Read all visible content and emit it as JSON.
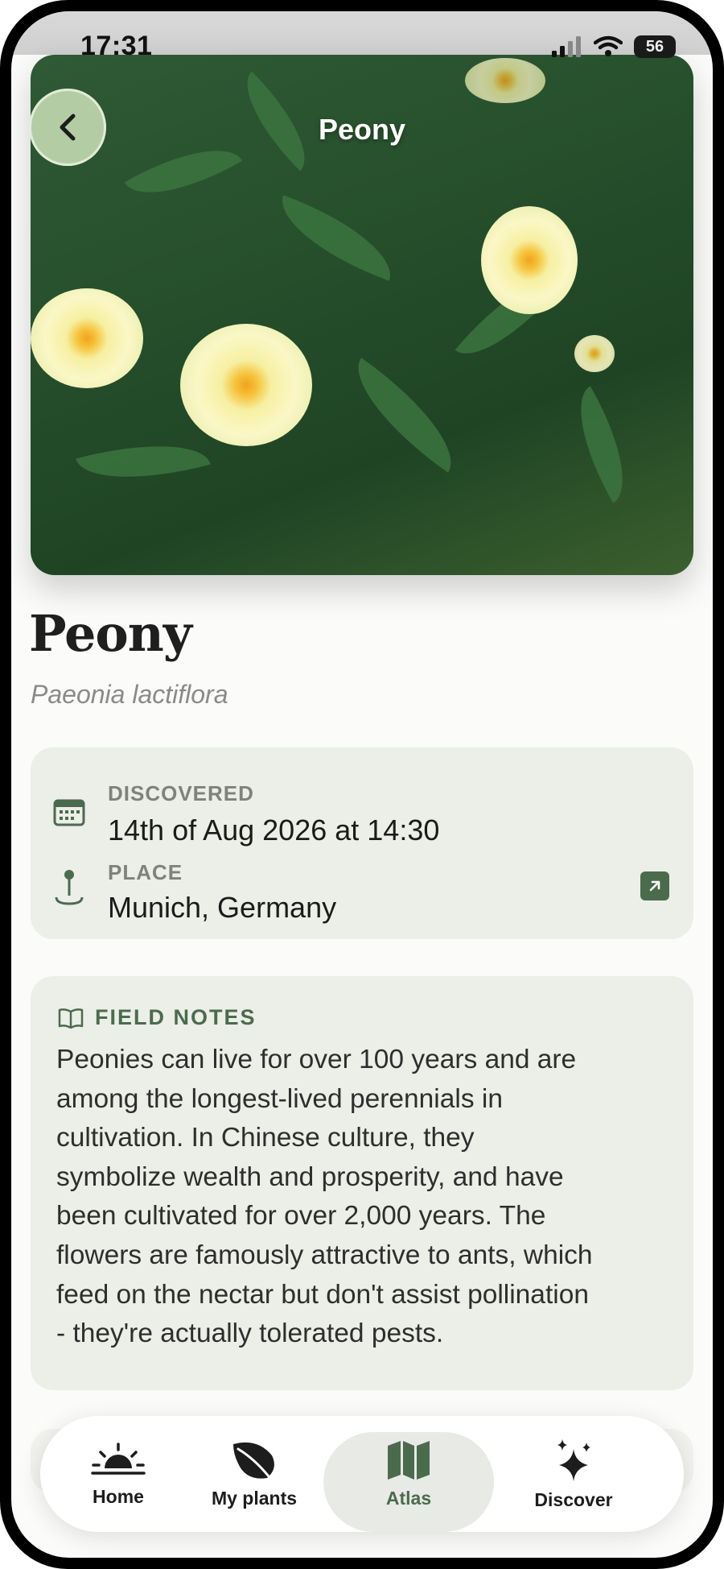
{
  "status_bar": {
    "time": "17:31",
    "battery": "56"
  },
  "header": {
    "title": "Peony",
    "back_label": "Back"
  },
  "plant": {
    "name": "Peony",
    "scientific_name": "Paeonia lactiflora"
  },
  "details": {
    "discovered_label": "DISCOVERED",
    "discovered_value": "14th of Aug 2026 at 14:30",
    "place_label": "PLACE",
    "place_value": "Munich, Germany"
  },
  "field_notes": {
    "title": "FIELD NOTES",
    "lines": [
      "Peonies can live for over 100 years and are",
      "among the longest-lived perennials in",
      "cultivation. In Chinese culture, they",
      "symbolize wealth and prosperity, and have",
      "been cultivated for over 2,000 years. The",
      "flowers are famously attractive to ants, which",
      "feed on the nectar but don't assist pollination",
      "- they're actually tolerated pests."
    ]
  },
  "tabs": [
    {
      "label": "Home",
      "icon": "sunrise-icon"
    },
    {
      "label": "My plants",
      "icon": "leaf-icon"
    },
    {
      "label": "Atlas",
      "icon": "map-icon"
    },
    {
      "label": "Discover",
      "icon": "sparkles-icon"
    }
  ],
  "active_tab": "Atlas",
  "colors": {
    "accent": "#4b6b4d",
    "card": "#eceee8",
    "text": "#1b1b1b",
    "muted": "#8a8a8a"
  }
}
